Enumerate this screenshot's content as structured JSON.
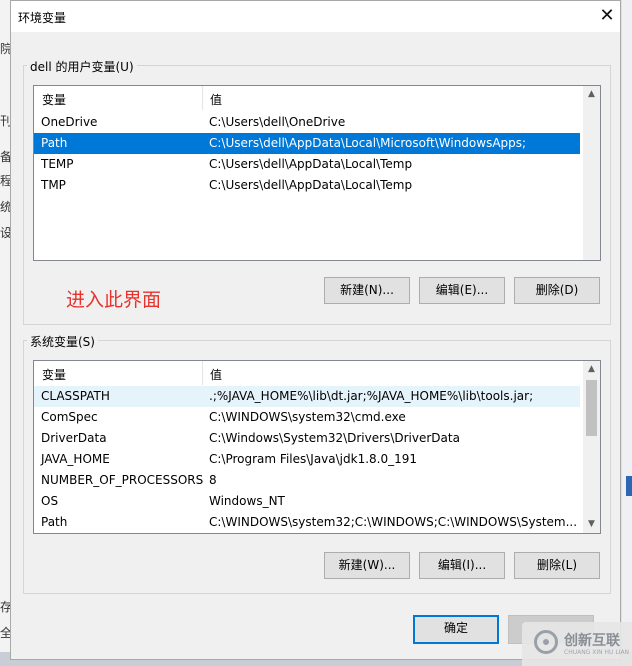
{
  "window": {
    "title": "环境变量",
    "close_glyph": "✕"
  },
  "background": {
    "left_glyphs": [
      "院",
      "刊",
      "备",
      "程",
      "统",
      "设",
      "存",
      "全"
    ]
  },
  "user_vars": {
    "group_title": "dell 的用户变量(U)",
    "columns": [
      "变量",
      "值"
    ],
    "rows": [
      {
        "name": "OneDrive",
        "value": "C:\\Users\\dell\\OneDrive",
        "selected": false
      },
      {
        "name": "Path",
        "value": "C:\\Users\\dell\\AppData\\Local\\Microsoft\\WindowsApps;",
        "selected": true
      },
      {
        "name": "TEMP",
        "value": "C:\\Users\\dell\\AppData\\Local\\Temp",
        "selected": false
      },
      {
        "name": "TMP",
        "value": "C:\\Users\\dell\\AppData\\Local\\Temp",
        "selected": false
      }
    ],
    "buttons": {
      "new": "新建(N)...",
      "edit": "编辑(E)...",
      "delete": "删除(D)"
    }
  },
  "annotation_text": "进入此界面",
  "system_vars": {
    "group_title": "系统变量(S)",
    "columns": [
      "变量",
      "值"
    ],
    "rows": [
      {
        "name": "CLASSPATH",
        "value": ".;%JAVA_HOME%\\lib\\dt.jar;%JAVA_HOME%\\lib\\tools.jar;",
        "hover": true
      },
      {
        "name": "ComSpec",
        "value": "C:\\WINDOWS\\system32\\cmd.exe",
        "hover": false
      },
      {
        "name": "DriverData",
        "value": "C:\\Windows\\System32\\Drivers\\DriverData",
        "hover": false
      },
      {
        "name": "JAVA_HOME",
        "value": "C:\\Program Files\\Java\\jdk1.8.0_191",
        "hover": false
      },
      {
        "name": "NUMBER_OF_PROCESSORS",
        "value": "8",
        "hover": false
      },
      {
        "name": "OS",
        "value": "Windows_NT",
        "hover": false
      },
      {
        "name": "Path",
        "value": "C:\\WINDOWS\\system32;C:\\WINDOWS;C:\\WINDOWS\\System...",
        "hover": false
      }
    ],
    "buttons": {
      "new": "新建(W)...",
      "edit": "编辑(I)...",
      "delete": "删除(L)"
    }
  },
  "footer": {
    "ok": "确定",
    "cancel": ""
  },
  "watermark": {
    "text": "创新互联",
    "sub": "CHUANG XIN HU LIAN"
  },
  "colors": {
    "selection": "#0078d7",
    "hover": "#e5f3fb",
    "annotation": "#e8322c",
    "default_border": "#0078d7"
  }
}
